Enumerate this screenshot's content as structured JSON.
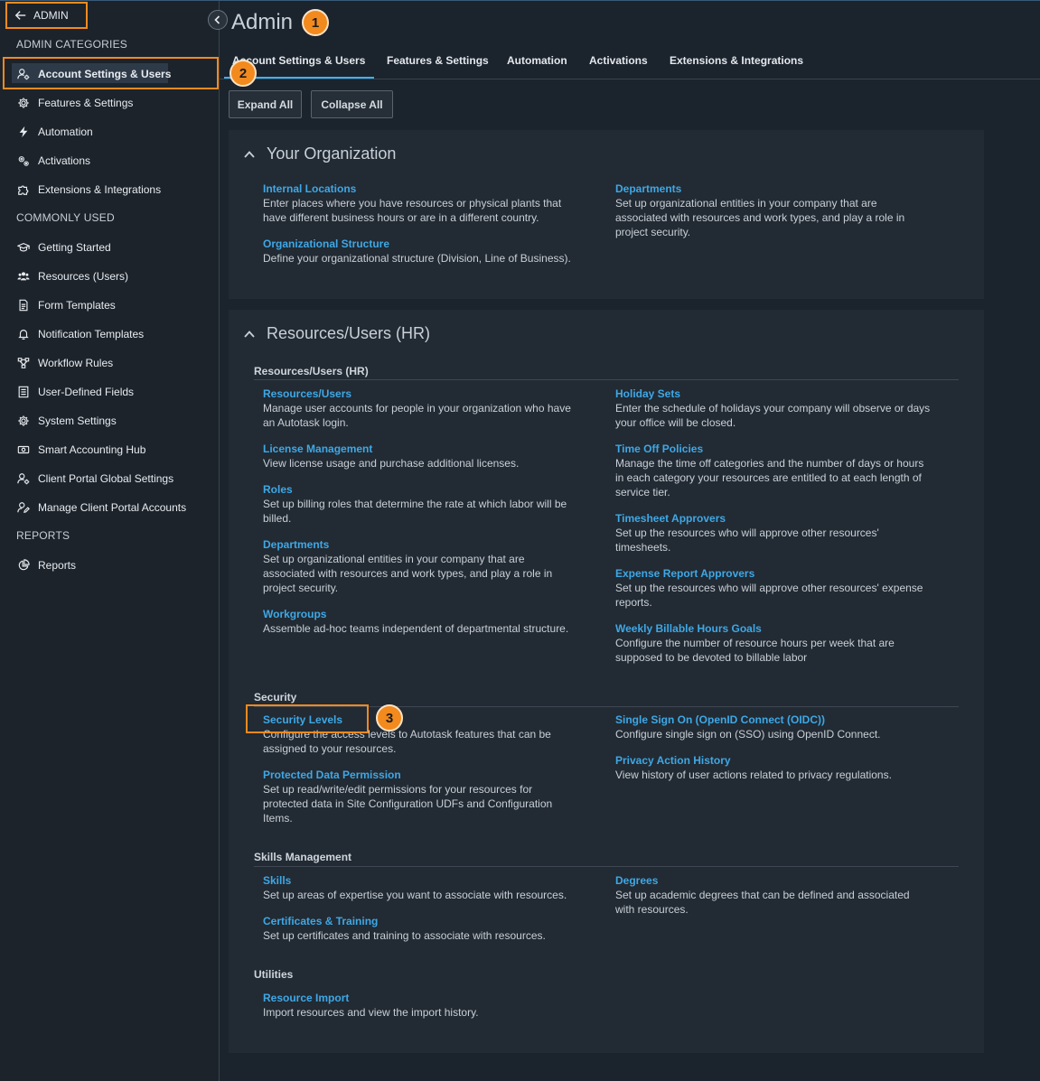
{
  "sidebar": {
    "admin_label": "ADMIN",
    "sections": {
      "admin_categories": "ADMIN CATEGORIES",
      "commonly_used": "COMMONLY USED",
      "reports": "REPORTS"
    },
    "admin_items": [
      {
        "label": "Account Settings & Users",
        "icon": "user-gear-icon"
      },
      {
        "label": "Features & Settings",
        "icon": "gear-icon"
      },
      {
        "label": "Automation",
        "icon": "lightning-icon"
      },
      {
        "label": "Activations",
        "icon": "gears-icon"
      },
      {
        "label": "Extensions & Integrations",
        "icon": "puzzle-icon"
      }
    ],
    "common_items": [
      {
        "label": "Getting Started",
        "icon": "graduation-cap-icon"
      },
      {
        "label": "Resources (Users)",
        "icon": "users-icon"
      },
      {
        "label": "Form Templates",
        "icon": "document-icon"
      },
      {
        "label": "Notification Templates",
        "icon": "bell-icon"
      },
      {
        "label": "Workflow Rules",
        "icon": "workflow-icon"
      },
      {
        "label": "User-Defined Fields",
        "icon": "list-icon"
      },
      {
        "label": "System Settings",
        "icon": "gear-icon"
      },
      {
        "label": "Smart Accounting Hub",
        "icon": "money-icon"
      },
      {
        "label": "Client Portal Global Settings",
        "icon": "user-gear-icon"
      },
      {
        "label": "Manage Client Portal Accounts",
        "icon": "user-edit-icon"
      }
    ],
    "report_items": [
      {
        "label": "Reports",
        "icon": "chart-pie-icon"
      }
    ]
  },
  "badges": [
    "1",
    "2",
    "3"
  ],
  "header": {
    "title": "Admin"
  },
  "tabs": [
    {
      "label": "Account Settings & Users"
    },
    {
      "label": "Features & Settings"
    },
    {
      "label": "Automation"
    },
    {
      "label": "Activations"
    },
    {
      "label": "Extensions & Integrations"
    }
  ],
  "toolbar": {
    "expand_all": "Expand All",
    "collapse_all": "Collapse All"
  },
  "org_panel": {
    "title": "Your Organization",
    "entries": [
      {
        "link": "Internal Locations",
        "desc": "Enter places where you have resources or physical plants that have different business hours or are in a different country."
      },
      {
        "link": "Organizational Structure",
        "desc": "Define your organizational structure (Division, Line of Business)."
      },
      {
        "link": "Departments",
        "desc": "Set up organizational entities in your company that are associated with resources and work types, and play a role in project security."
      }
    ]
  },
  "hr_panel": {
    "title": "Resources/Users (HR)",
    "groups": {
      "resources": "Resources/Users (HR)",
      "security": "Security",
      "skills": "Skills Management",
      "utilities": "Utilities"
    },
    "resources_left": [
      {
        "link": "Resources/Users",
        "desc": "Manage user accounts for people in your organization who have an Autotask login."
      },
      {
        "link": "License Management",
        "desc": "View license usage and purchase additional licenses."
      },
      {
        "link": "Roles",
        "desc": "Set up billing roles that determine the rate at which labor will be billed."
      },
      {
        "link": "Departments",
        "desc": "Set up organizational entities in your company that are associated with resources and work types, and play a role in project security."
      },
      {
        "link": "Workgroups",
        "desc": "Assemble ad-hoc teams independent of departmental structure."
      }
    ],
    "resources_right": [
      {
        "link": "Holiday Sets",
        "desc": "Enter the schedule of holidays your company will observe or days your office will be closed."
      },
      {
        "link": "Time Off Policies",
        "desc": "Manage the time off categories and the number of days or hours in each category your resources are entitled to at each length of service tier."
      },
      {
        "link": "Timesheet Approvers",
        "desc": "Set up the resources who will approve other resources' timesheets."
      },
      {
        "link": "Expense Report Approvers",
        "desc": "Set up the resources who will approve other resources' expense reports."
      },
      {
        "link": "Weekly Billable Hours Goals",
        "desc": "Configure the number of resource hours per week that are supposed to be devoted to billable labor"
      }
    ],
    "security_left": [
      {
        "link": "Security Levels",
        "desc": "Configure the access levels to Autotask features that can be assigned to your resources."
      },
      {
        "link": "Protected Data Permission",
        "desc": "Set up read/write/edit permissions for your resources for protected data in Site Configuration UDFs and Configuration Items."
      }
    ],
    "security_right": [
      {
        "link": "Single Sign On (OpenID Connect (OIDC))",
        "desc": "Configure single sign on (SSO) using OpenID Connect."
      },
      {
        "link": "Privacy Action History",
        "desc": "View history of user actions related to privacy regulations."
      }
    ],
    "skills_left": [
      {
        "link": "Skills",
        "desc": "Set up areas of expertise you want to associate with resources."
      },
      {
        "link": "Certificates & Training",
        "desc": "Set up certificates and training to associate with resources."
      }
    ],
    "skills_right": [
      {
        "link": "Degrees",
        "desc": "Set up academic degrees that can be defined and associated with resources."
      }
    ],
    "utilities_left": [
      {
        "link": "Resource Import",
        "desc": "Import resources and view the import history."
      }
    ]
  }
}
